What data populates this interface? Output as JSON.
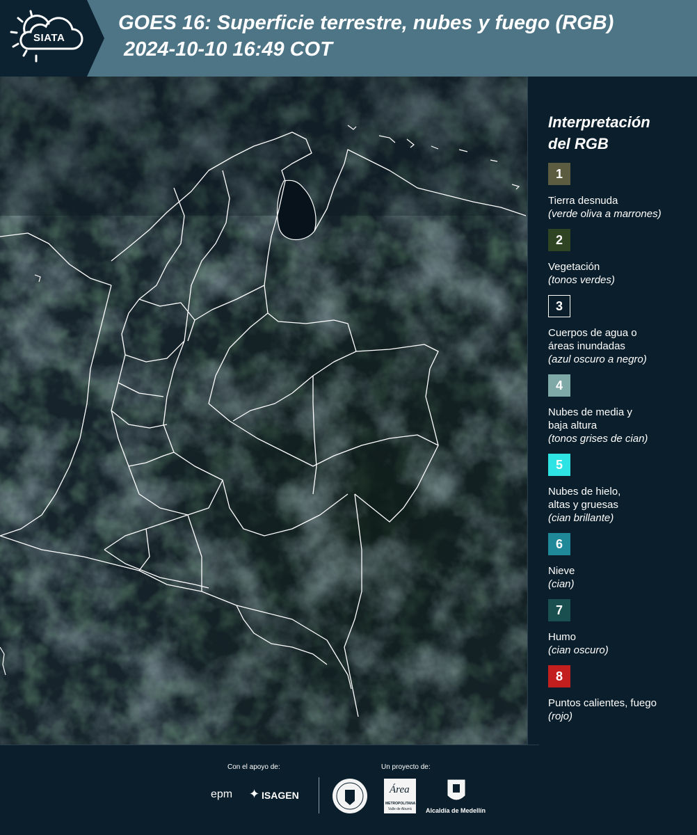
{
  "header": {
    "logo_text": "SIATA",
    "title_line1": "GOES 16: Superficie terrestre, nubes y fuego (RGB)",
    "title_line2": "2024-10-10 16:49 COT"
  },
  "legend": {
    "title_line1": "Interpretación",
    "title_line2": "del RGB",
    "items": [
      {
        "num": "1",
        "color": "#5c5c40",
        "lines": [
          "Tierra desnuda"
        ],
        "sub": "(verde oliva a marrones)"
      },
      {
        "num": "2",
        "color": "#2e4423",
        "lines": [
          "Vegetación"
        ],
        "sub": "(tonos verdes)"
      },
      {
        "num": "3",
        "color": "#0b1e2b",
        "lines": [
          "Cuerpos de agua o",
          "áreas inundadas"
        ],
        "sub": "(azul oscuro a negro)"
      },
      {
        "num": "4",
        "color": "#7fa9a7",
        "lines": [
          "Nubes de media y",
          "baja altura"
        ],
        "sub": "(tonos grises de cian)"
      },
      {
        "num": "5",
        "color": "#2ee3e3",
        "lines": [
          "Nubes de hielo,",
          "altas y gruesas"
        ],
        "sub": "(cian brillante)"
      },
      {
        "num": "6",
        "color": "#1f8999",
        "lines": [
          "Nieve"
        ],
        "sub": "(cian)"
      },
      {
        "num": "7",
        "color": "#1a4f4f",
        "lines": [
          "Humo"
        ],
        "sub": "(cian oscuro)"
      },
      {
        "num": "8",
        "color": "#c41f1f",
        "lines": [
          "Puntos calientes, fuego"
        ],
        "sub": "(rojo)"
      }
    ]
  },
  "footer": {
    "support_label": "Con el apoyo de:",
    "project_label": "Un proyecto de:",
    "sponsor1": "epm",
    "sponsor2": "ISAGEN",
    "partner1": "Área Metropolitana",
    "partner2": "Alcaldía de Medellín",
    "area_line1": "METROPOLITANA",
    "area_line2": "Valle de Aburrá",
    "area_word": "Área"
  },
  "icons": [
    "siata-sun-cloud-logo",
    "university-seal-icon",
    "area-metropolitana-logo",
    "alcaldia-shield-icon",
    "isagen-star-icon"
  ]
}
